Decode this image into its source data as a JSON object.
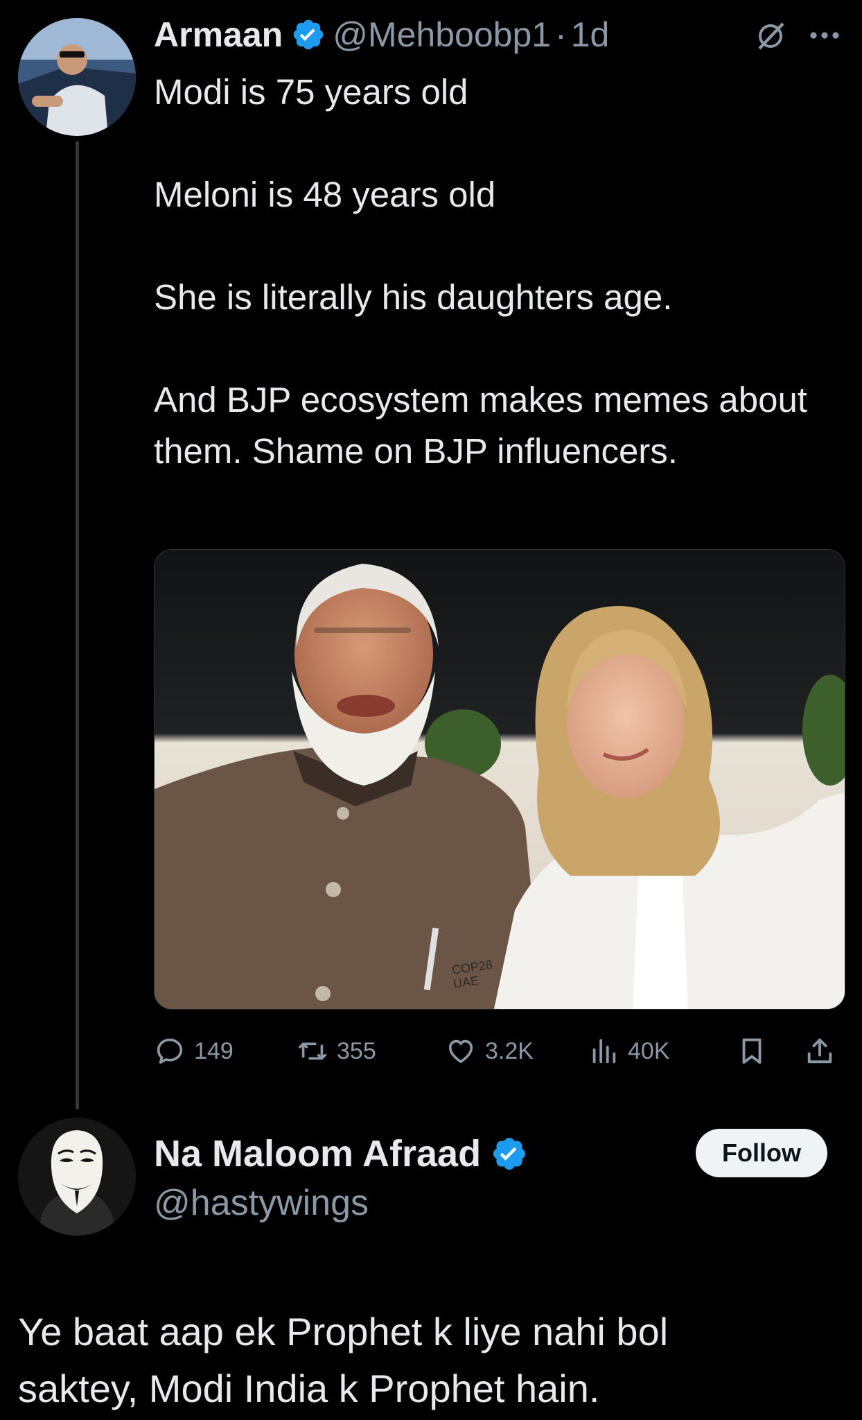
{
  "tweet": {
    "author": {
      "display_name": "Armaan",
      "handle": "@Mehboobp1",
      "verified": true,
      "avatar": "avatar-photo"
    },
    "separator": "·",
    "time": "1d",
    "text_paragraphs": [
      "Modi is 75 years old",
      "Meloni is 48 years old",
      "She is literally his daughters age.",
      "And BJP ecosystem makes memes about them. Shame on BJP influencers."
    ],
    "media": {
      "type": "photo",
      "pin_text_top": "COP28",
      "pin_text_bottom": "UAE"
    },
    "actions": {
      "replies": "149",
      "reposts": "355",
      "likes": "3.2K",
      "views": "40K"
    },
    "icons": {
      "verified": "verified-badge-icon",
      "grok": "grok-icon",
      "more": "more-icon",
      "reply": "reply-icon",
      "repost": "repost-icon",
      "like": "heart-icon",
      "views": "views-icon",
      "bookmark": "bookmark-icon",
      "share": "share-icon"
    }
  },
  "reply": {
    "author": {
      "display_name": "Na Maloom Afraad",
      "handle": "@hastywings",
      "verified": true,
      "avatar": "masked-avatar"
    },
    "follow_label": "Follow",
    "text_lines": [
      "Ye baat aap ek Prophet k liye nahi bol",
      "saktey, Modi India k Prophet hain."
    ]
  },
  "colors": {
    "background": "#000000",
    "text_primary": "#e7e9ea",
    "text_secondary": "#8b98a5",
    "verified_blue": "#1d9bf0",
    "follow_button_bg": "#eff3f4"
  }
}
